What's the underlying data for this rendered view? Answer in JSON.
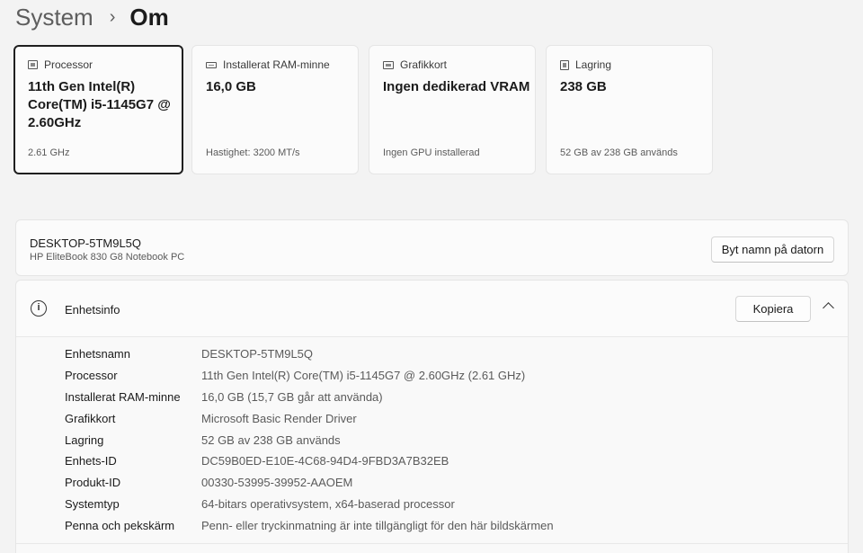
{
  "breadcrumb": {
    "parent": "System",
    "separator": "›",
    "current": "Om"
  },
  "cards": [
    {
      "icon": "processor-icon",
      "label": "Processor",
      "value": "11th Gen Intel(R) Core(TM) i5-1145G7 @ 2.60GHz",
      "sub": "2.61 GHz",
      "selected": true
    },
    {
      "icon": "ram-icon",
      "label": "Installerat RAM-minne",
      "value": "16,0 GB",
      "sub": "Hastighet: 3200 MT/s"
    },
    {
      "icon": "gpu-icon",
      "label": "Grafikkort",
      "value": "Ingen dedikerad VRAM",
      "sub": "Ingen GPU installerad"
    },
    {
      "icon": "storage-icon",
      "label": "Lagring",
      "value": "238 GB",
      "sub": "52 GB av 238 GB används"
    }
  ],
  "device": {
    "name": "DESKTOP-5TM9L5Q",
    "model": "HP EliteBook 830 G8 Notebook PC",
    "rename_label": "Byt namn på datorn"
  },
  "info": {
    "title": "Enhetsinfo",
    "copy_label": "Kopiera",
    "rows": [
      {
        "key": "Enhetsnamn",
        "value": "DESKTOP-5TM9L5Q"
      },
      {
        "key": "Processor",
        "value": "11th Gen Intel(R) Core(TM) i5-1145G7 @ 2.60GHz (2.61 GHz)"
      },
      {
        "key": "Installerat RAM-minne",
        "value": "16,0 GB (15,7 GB går att använda)"
      },
      {
        "key": "Grafikkort",
        "value": "Microsoft Basic Render Driver"
      },
      {
        "key": "Lagring",
        "value": "52 GB av 238 GB används"
      },
      {
        "key": "Enhets-ID",
        "value": "DC59B0ED-E10E-4C68-94D4-9FBD3A7B32EB"
      },
      {
        "key": "Produkt-ID",
        "value": "00330-53995-39952-AAOEM"
      },
      {
        "key": "Systemtyp",
        "value": "64-bitars operativsystem, x64-baserad processor"
      },
      {
        "key": "Penna och pekskärm",
        "value": "Penn- eller tryckinmatning är inte tillgängligt för den här bildskärmen"
      }
    ]
  }
}
